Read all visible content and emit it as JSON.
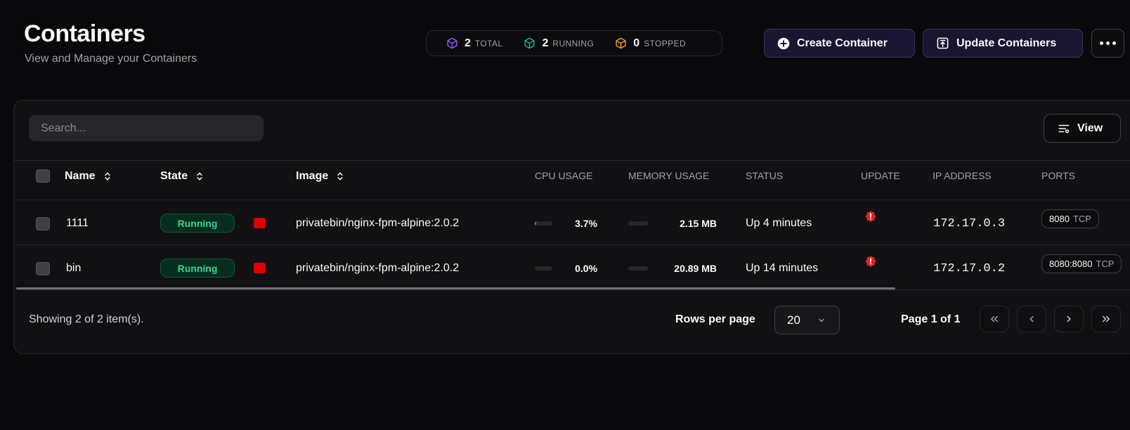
{
  "header": {
    "title": "Containers",
    "subtitle": "View and Manage your Containers"
  },
  "stats": {
    "total": {
      "value": "2",
      "label": "TOTAL",
      "color": "#8b5cf6"
    },
    "running": {
      "value": "2",
      "label": "RUNNING",
      "color": "#10b981"
    },
    "stopped": {
      "value": "0",
      "label": "STOPPED",
      "color": "#f59e0b"
    }
  },
  "actions": {
    "create_label": "Create Container",
    "update_label": "Update Containers"
  },
  "toolbar": {
    "search_placeholder": "Search...",
    "view_label": "View"
  },
  "table": {
    "columns": {
      "name": "Name",
      "state": "State",
      "image": "Image",
      "cpu": "CPU USAGE",
      "memory": "MEMORY USAGE",
      "status": "STATUS",
      "update": "UPDATE",
      "ip": "IP ADDRESS",
      "ports": "PORTS"
    },
    "rows": [
      {
        "name": "1111",
        "state": "Running",
        "image": "privatebin/nginx-fpm-alpine:2.0.2",
        "cpu": "3.7%",
        "cpu_fraction": 0.037,
        "memory": "2.15 MB",
        "status": "Up 4 minutes",
        "ip": "172.17.0.3",
        "port": "8080",
        "proto": "TCP"
      },
      {
        "name": "bin",
        "state": "Running",
        "image": "privatebin/nginx-fpm-alpine:2.0.2",
        "cpu": "0.0%",
        "cpu_fraction": 0.0,
        "memory": "20.89 MB",
        "status": "Up 14 minutes",
        "ip": "172.17.0.2",
        "port": "8080:8080",
        "proto": "TCP"
      }
    ]
  },
  "footer": {
    "showing": "Showing 2 of 2 item(s).",
    "rows_per_page_label": "Rows per page",
    "rows_per_page_value": "20",
    "page_info": "Page 1 of 1"
  }
}
